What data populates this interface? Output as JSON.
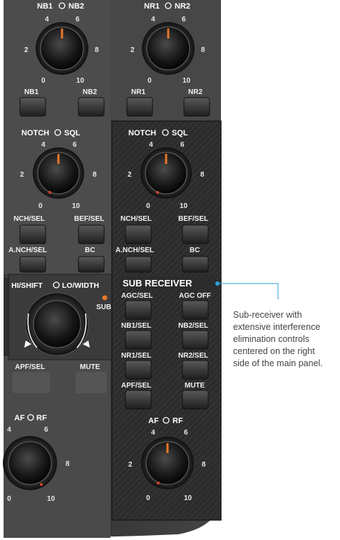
{
  "colors": {
    "accent_blue": "#2a9fd8",
    "indicator": "#e8762a",
    "panel": "#3a3a3a"
  },
  "main_panel": {
    "nb_knob": {
      "label_left": "NB1",
      "label_right": "NB2",
      "scale": [
        "4",
        "6",
        "2",
        "8",
        "0",
        "10"
      ]
    },
    "nr_knob": {
      "label_left": "NR1",
      "label_right": "NR2",
      "scale": [
        "4",
        "6",
        "2",
        "8",
        "0",
        "10"
      ]
    },
    "buttons_top": [
      "NB1",
      "NB2",
      "NR1",
      "NR2"
    ],
    "notch_knob": {
      "label_left": "NOTCH",
      "label_right": "SQL",
      "scale": [
        "4",
        "6",
        "2",
        "8",
        "0",
        "10"
      ]
    },
    "buttons_mid": [
      "NCH/SEL",
      "BEF/SEL",
      "A.NCH/SEL",
      "BC"
    ],
    "shift_knob": {
      "label_left": "HI/SHIFT",
      "label_right": "LO/WIDTH",
      "sub_label": "SUB"
    },
    "buttons_low": [
      "APF/SEL",
      "MUTE"
    ],
    "af_knob": {
      "label_left": "AF",
      "label_right": "RF",
      "scale": [
        "4",
        "6",
        "8",
        "0",
        "10"
      ]
    }
  },
  "sub_receiver": {
    "title": "SUB RECEIVER",
    "notch_knob": {
      "label_left": "NOTCH",
      "label_right": "SQL",
      "scale": [
        "4",
        "6",
        "2",
        "8",
        "0",
        "10"
      ]
    },
    "buttons": [
      "NCH/SEL",
      "BEF/SEL",
      "A.NCH/SEL",
      "BC",
      "AGC/SEL",
      "AGC OFF",
      "NB1/SEL",
      "NB2/SEL",
      "NR1/SEL",
      "NR2/SEL",
      "APF/SEL",
      "MUTE"
    ],
    "af_knob": {
      "label_left": "AF",
      "label_right": "RF",
      "scale": [
        "4",
        "6",
        "2",
        "8",
        "0",
        "10"
      ]
    }
  },
  "caption": {
    "lines": [
      "Sub-receiver with",
      "extensive interference",
      "elimination controls",
      "centered on the right",
      "side of the main panel."
    ]
  }
}
